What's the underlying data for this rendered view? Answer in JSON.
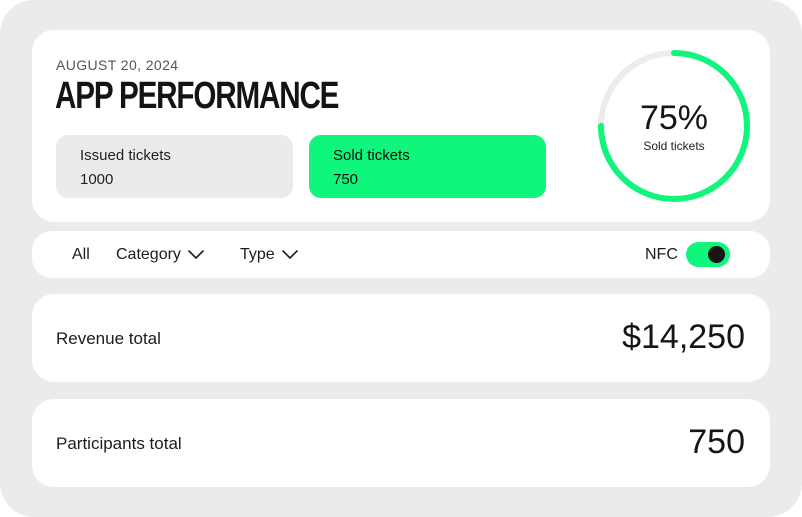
{
  "header": {
    "date": "AUGUST 20, 2024",
    "title": "APP PERFORMANCE",
    "issued": {
      "label": "Issued tickets",
      "value": "1000"
    },
    "sold": {
      "label": "Sold tickets",
      "value": "750"
    },
    "ring": {
      "percent_text": "75%",
      "label": "Sold tickets",
      "fraction": 0.75
    }
  },
  "filters": {
    "all": "All",
    "category": "Category",
    "type": "Type",
    "nfc_label": "NFC",
    "nfc_on": true
  },
  "totals": {
    "revenue": {
      "label": "Revenue total",
      "value": "$14,250"
    },
    "participants": {
      "label": "Participants total",
      "value": "750"
    }
  },
  "colors": {
    "accent": "#10f57c",
    "track": "#ececec",
    "background": "#ebebeb"
  },
  "icons": {
    "category_chevron": "chevron-down-icon",
    "type_chevron": "chevron-down-icon"
  }
}
